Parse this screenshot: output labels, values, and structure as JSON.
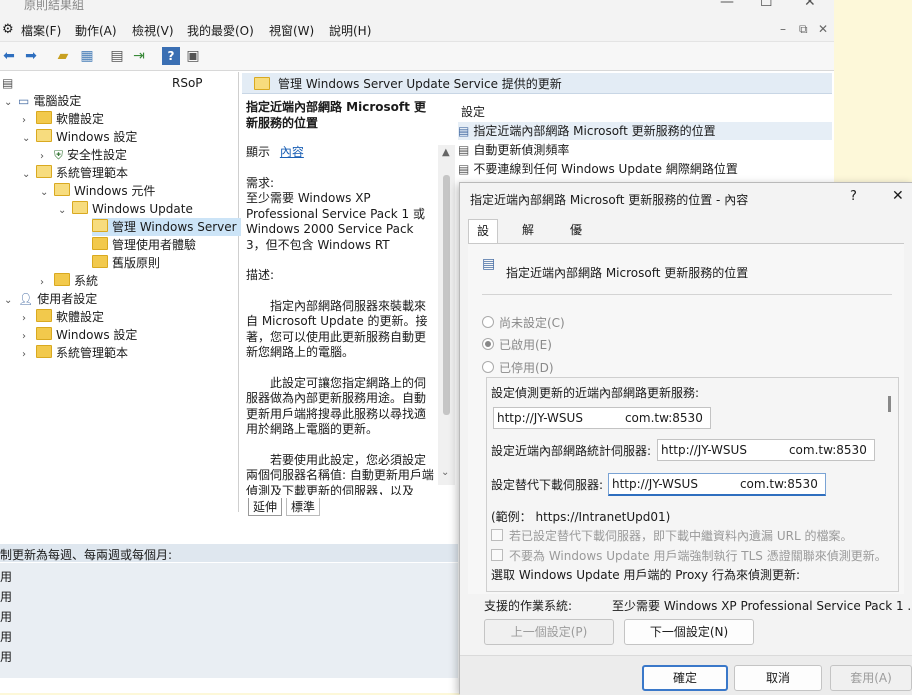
{
  "window": {
    "title": "原則結果組",
    "menu": [
      "檔案(F)",
      "動作(A)",
      "檢視(V)",
      "我的最愛(O)",
      "視窗(W)",
      "說明(H)"
    ]
  },
  "tree": {
    "root_label": "RSoP",
    "items": [
      {
        "label": "電腦設定"
      },
      {
        "label": "軟體設定"
      },
      {
        "label": "Windows 設定"
      },
      {
        "label": "安全性設定"
      },
      {
        "label": "系統管理範本"
      },
      {
        "label": "Windows 元件"
      },
      {
        "label": "Windows Update"
      },
      {
        "label": "管理 Windows Server"
      },
      {
        "label": "管理使用者體驗"
      },
      {
        "label": "舊版原則"
      },
      {
        "label": "系統"
      },
      {
        "label": "使用者設定"
      },
      {
        "label": "軟體設定"
      },
      {
        "label": "Windows 設定"
      },
      {
        "label": "系統管理範本"
      }
    ]
  },
  "pane": {
    "header": "管理 Windows Server Update Service 提供的更新",
    "desc_title": "指定近端內部網路 Microsoft 更新服務的位置",
    "show_label": "顯示",
    "show_link": "內容",
    "req_label": "需求:",
    "req_text": "至少需要 Windows XP Professional Service Pack 1 或 Windows 2000 Service Pack 3，但不包含 Windows RT",
    "desc_label": "描述:",
    "desc_p1": "指定內部網路伺服器來裝載來自 Microsoft Update 的更新。接著，您可以使用此更新服務自動更新您網路上的電腦。",
    "desc_p2": "此設定可讓您指定網路上的伺服器做為內部更新服務用途。自動更新用戶端將搜尋此服務以尋找適用於網路上電腦的更新。",
    "desc_p3": "若要使用此設定，您必須設定兩個伺服器名稱值: 自動更新用戶端偵測及下載更新的伺服器，以及",
    "settings_header": "設定",
    "settings": [
      "指定近端內部網路 Microsoft 更新服務的位置",
      "自動更新偵測頻率",
      "不要連線到任何 Windows Update 網際網路位置"
    ],
    "tabs": [
      "延伸",
      "標準"
    ]
  },
  "status": {
    "header": "制更新為每週、每兩週或每個月:",
    "rows": [
      "用",
      "用",
      "用",
      "用",
      "用"
    ]
  },
  "dialog": {
    "title": "指定近端內部網路 Microsoft 更新服務的位置 - 內容",
    "help": "?",
    "close": "✕",
    "tabs": [
      "設定",
      "解說",
      "優先順序"
    ],
    "policy_name": "指定近端內部網路 Microsoft 更新服務的位置",
    "radios": [
      "尚未設定(C)",
      "已啟用(E)",
      "已停用(D)"
    ],
    "opt_detect_label": "設定偵測更新的近端內部網路更新服務:",
    "opt_detect_value": "http://JY-WSUS",
    "opt_detect_suffix": "com.tw:8530",
    "opt_stats_label": "設定近端內部網路統計伺服器:",
    "opt_stats_value": "http://JY-WSUS",
    "opt_stats_suffix": "com.tw:8530",
    "opt_alt_label": "設定替代下載伺服器:",
    "opt_alt_value": "http://JY-WSUS",
    "opt_alt_suffix": "com.tw:8530",
    "example": "(範例： https://IntranetUpd01)",
    "chk1": "若已設定替代下載伺服器，即下載中繼資料內遺漏 URL 的檔案。",
    "chk2": "不要為 Windows Update 用戶端強制執行 TLS 憑證關聯來偵測更新。",
    "proxy_label": "選取 Windows Update 用戶端的 Proxy 行為來偵測更新:",
    "supported_label": "支援的作業系統:",
    "supported_value": "至少需要 Windows XP Professional Service Pack 1 ...",
    "prev_btn": "上一個設定(P)",
    "next_btn": "下一個設定(N)",
    "ok_btn": "確定",
    "cancel_btn": "取消",
    "apply_btn": "套用(A)"
  }
}
